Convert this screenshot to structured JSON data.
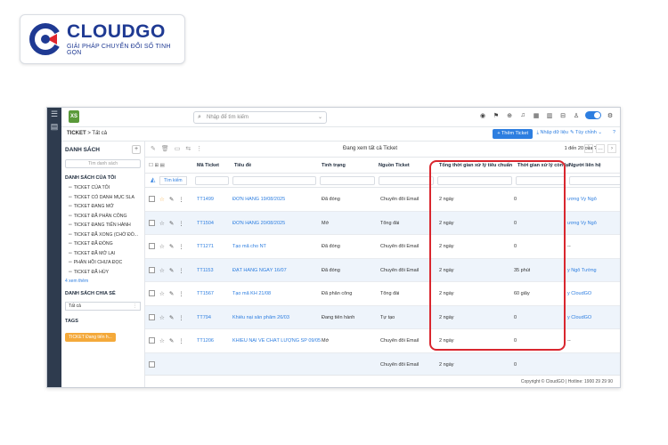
{
  "logo": {
    "name": "CLOUDGO",
    "tagline": "GIẢI PHÁP CHUYỂN ĐỔI SỐ TINH GỌN"
  },
  "topbar": {
    "search_placeholder": "Nhập để tìm kiếm"
  },
  "breadcrumb": {
    "module": "TICKET",
    "separator": ">",
    "current": "Tất cả"
  },
  "actions": {
    "add": "+ Thêm Ticket",
    "import": "Nhập dữ liệu",
    "customize": "Tùy chỉnh"
  },
  "sidebar": {
    "title": "DANH SÁCH",
    "search_placeholder": "Tìm danh sách",
    "mine_title": "DANH SÁCH CỦA TÔI",
    "items": [
      "TICKET CỦA TÔI",
      "TICKET CÓ DANH MỤC SLA",
      "TICKET ĐANG MỞ",
      "TICKET ĐÃ PHÂN CÔNG",
      "TICKET ĐANG TIẾN HÀNH",
      "TICKET ĐÃ XONG (CHỜ ĐÓ...",
      "TICKET ĐÃ ĐÓNG",
      "TICKET ĐÃ MỞ LẠI",
      "PHẢN HỒI CHƯA ĐỌC",
      "TICKET ĐÃ HỦY"
    ],
    "more": "4 xem thêm",
    "shared_title": "DANH SÁCH CHIA SẺ",
    "shared_item": "Tất cả",
    "tags_title": "TAGS",
    "tag_chip": "TICKET Đang tiến h..."
  },
  "toolbar": {
    "viewing": "Đang xem tất cả Ticket",
    "paging": "1 đến 20 của ?"
  },
  "table": {
    "search_btn": "Tìm kiếm",
    "headers": {
      "id": "Mã Ticket",
      "title": "Tiêu đề",
      "status": "Tình trạng",
      "source": "Nguồn Ticket",
      "sla_total": "Tổng thời gian xử lý tiêu chuẩn",
      "sla_left": "Thời gian xử lý còn lại",
      "owner": "Người liên hệ"
    },
    "rows": [
      {
        "id": "TT1499",
        "title": "ĐƠN HÀNG 19/08/2025",
        "status": "Đã đóng",
        "source": "Chuyển đổi Email",
        "total": "2 ngày",
        "left": "0",
        "owner": "ương Vy Ngô"
      },
      {
        "id": "TT1504",
        "title": "ĐƠN HÀNG 20/08/2025",
        "status": "Mở",
        "source": "Tổng đài",
        "total": "2 ngày",
        "left": "0",
        "owner": "ương Vy Ngô"
      },
      {
        "id": "TT1271",
        "title": "Tạo mã cho NT",
        "status": "Đã đóng",
        "source": "Chuyển đổi Email",
        "total": "2 ngày",
        "left": "0",
        "owner": "--"
      },
      {
        "id": "TT1153",
        "title": "ĐẶT HÀNG NGÀY 16/07",
        "status": "Đã đóng",
        "source": "Chuyển đổi Email",
        "total": "2 ngày",
        "left": "35 phút",
        "owner": "y Ngô Tường"
      },
      {
        "id": "TT1567",
        "title": "Tạo mã KH 21/08",
        "status": "Đã phân công",
        "source": "Tổng đài",
        "total": "2 ngày",
        "left": "60 giây",
        "owner": "y CloudGO"
      },
      {
        "id": "TT794",
        "title": "Khiếu nại sản phẩm 26/03",
        "status": "Đang tiến hành",
        "source": "Tự tạo",
        "total": "2 ngày",
        "left": "0",
        "owner": "y CloudGO"
      },
      {
        "id": "TT1206",
        "title": "KHIẾU NẠI VỀ CHẤT LƯỢNG SP 09/05",
        "status": "Mở",
        "source": "Chuyển đổi Email",
        "total": "2 ngày",
        "left": "0",
        "owner": "--"
      },
      {
        "id": "",
        "title": "",
        "status": "",
        "source": "Chuyển đổi Email",
        "total": "2 ngày",
        "left": "0",
        "owner": ""
      }
    ]
  },
  "footer": {
    "text": "Copyright © CloudGO | Hotline: 1900 29 29 90"
  },
  "colors": {
    "brand": "#1f3a93",
    "accent": "#2d7ee0",
    "highlight": "#d9262e",
    "tag": "#f4a93a"
  }
}
